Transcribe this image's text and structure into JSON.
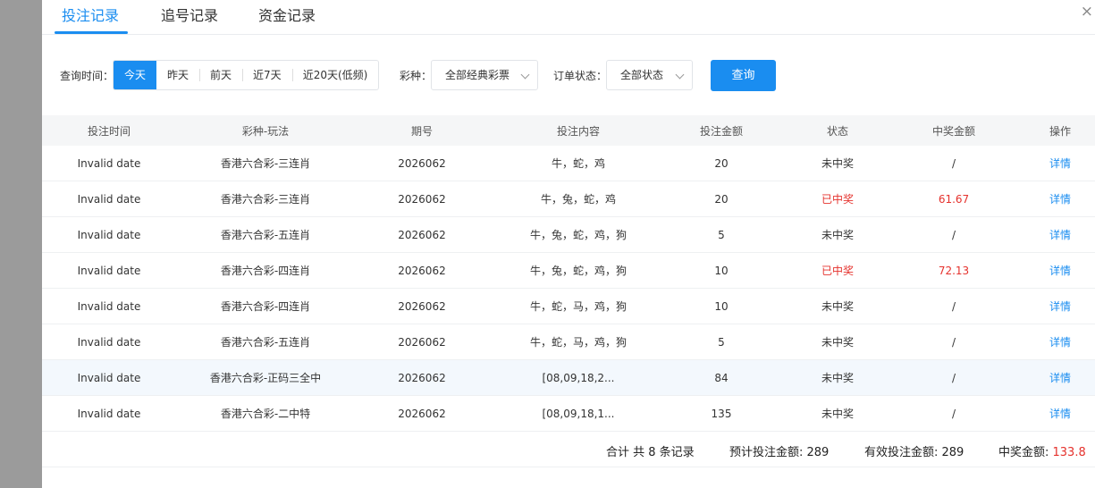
{
  "tabs": [
    {
      "label": "投注记录",
      "active": true
    },
    {
      "label": "追号记录",
      "active": false
    },
    {
      "label": "资金记录",
      "active": false
    }
  ],
  "close_icon": "×",
  "filters": {
    "time_label": "查询时间：",
    "time_options": [
      "今天",
      "昨天",
      "前天",
      "近7天",
      "近20天(低频)"
    ],
    "lottery_label": "彩种：",
    "lottery_value": "全部经典彩票",
    "status_label": "订单状态：",
    "status_value": "全部状态",
    "query_label": "查询"
  },
  "table": {
    "headers": [
      "投注时间",
      "彩种-玩法",
      "期号",
      "投注内容",
      "投注金额",
      "状态",
      "中奖金额",
      "操作"
    ],
    "rows": [
      {
        "time": "Invalid date",
        "game": "香港六合彩-三连肖",
        "issue": "2026062",
        "content": "牛，蛇，鸡",
        "amount": "20",
        "status": "未中奖",
        "prize": "/",
        "action": "详情",
        "won": false
      },
      {
        "time": "Invalid date",
        "game": "香港六合彩-三连肖",
        "issue": "2026062",
        "content": "牛，兔，蛇，鸡",
        "amount": "20",
        "status": "已中奖",
        "prize": "61.67",
        "action": "详情",
        "won": true
      },
      {
        "time": "Invalid date",
        "game": "香港六合彩-五连肖",
        "issue": "2026062",
        "content": "牛，兔，蛇，鸡，狗",
        "amount": "5",
        "status": "未中奖",
        "prize": "/",
        "action": "详情",
        "won": false
      },
      {
        "time": "Invalid date",
        "game": "香港六合彩-四连肖",
        "issue": "2026062",
        "content": "牛，兔，蛇，鸡，狗",
        "amount": "10",
        "status": "已中奖",
        "prize": "72.13",
        "action": "详情",
        "won": true
      },
      {
        "time": "Invalid date",
        "game": "香港六合彩-四连肖",
        "issue": "2026062",
        "content": "牛，蛇，马，鸡，狗",
        "amount": "10",
        "status": "未中奖",
        "prize": "/",
        "action": "详情",
        "won": false
      },
      {
        "time": "Invalid date",
        "game": "香港六合彩-五连肖",
        "issue": "2026062",
        "content": "牛，蛇，马，鸡，狗",
        "amount": "5",
        "status": "未中奖",
        "prize": "/",
        "action": "详情",
        "won": false
      },
      {
        "time": "Invalid date",
        "game": "香港六合彩-正码三全中",
        "issue": "2026062",
        "content": "[08,09,18,2...",
        "amount": "84",
        "status": "未中奖",
        "prize": "/",
        "action": "详情",
        "won": false
      },
      {
        "time": "Invalid date",
        "game": "香港六合彩-二中特",
        "issue": "2026062",
        "content": "[08,09,18,1...",
        "amount": "135",
        "status": "未中奖",
        "prize": "/",
        "action": "详情",
        "won": false
      }
    ]
  },
  "summary": {
    "total": "合计 共 8 条记录",
    "expected_label": "预计投注金额: ",
    "expected_value": "289",
    "valid_label": "有效投注金额: ",
    "valid_value": "289",
    "prize_label": "中奖金额: ",
    "prize_value": "133.8"
  },
  "colors": {
    "accent": "#1a8df0",
    "won": "#e5322d"
  }
}
